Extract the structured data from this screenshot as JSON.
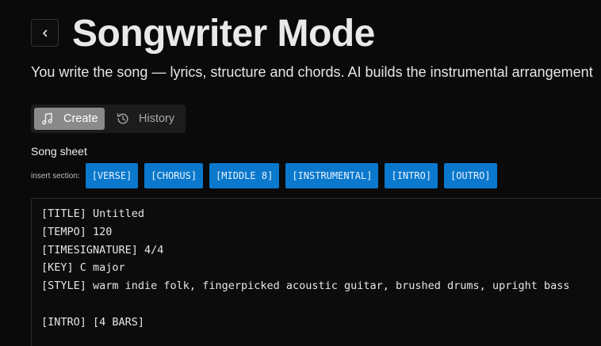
{
  "header": {
    "title": "Songwriter Mode",
    "subtitle": "You write the song — lyrics, structure and chords. AI builds the instrumental arrangement"
  },
  "tabs": [
    {
      "label": "Create",
      "icon": "music-note-icon",
      "active": true
    },
    {
      "label": "History",
      "icon": "history-icon",
      "active": false
    }
  ],
  "song_sheet": {
    "label": "Song sheet",
    "insert_label": "insert section:",
    "sections": [
      "[VERSE]",
      "[CHORUS]",
      "[MIDDLE 8]",
      "[INSTRUMENTAL]",
      "[INTRO]",
      "[OUTRO]"
    ],
    "lines": [
      "[TITLE] Untitled",
      "[TEMPO] 120",
      "[TIMESIGNATURE] 4/4",
      "[KEY] C major",
      "[STYLE] warm indie folk, fingerpicked acoustic guitar, brushed drums, upright bass",
      "",
      "[INTRO] [4 BARS]"
    ]
  },
  "colors": {
    "background": "#0a0a0a",
    "chip": "#0a78cc",
    "active_tab": "#8a8a8a"
  }
}
